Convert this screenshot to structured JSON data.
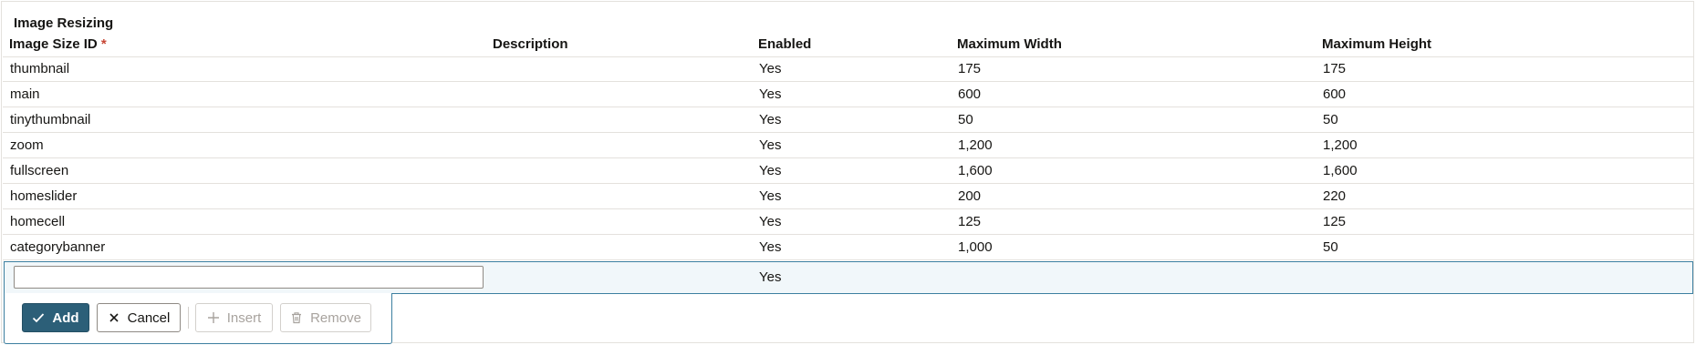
{
  "section": {
    "title": "Image Resizing"
  },
  "columns": {
    "id": "Image Size ID",
    "id_required_mark": "*",
    "description": "Description",
    "enabled": "Enabled",
    "max_width": "Maximum Width",
    "max_height": "Maximum Height"
  },
  "rows": [
    {
      "id": "thumbnail",
      "description": "",
      "enabled": "Yes",
      "max_width": "175",
      "max_height": "175"
    },
    {
      "id": "main",
      "description": "",
      "enabled": "Yes",
      "max_width": "600",
      "max_height": "600"
    },
    {
      "id": "tinythumbnail",
      "description": "",
      "enabled": "Yes",
      "max_width": "50",
      "max_height": "50"
    },
    {
      "id": "zoom",
      "description": "",
      "enabled": "Yes",
      "max_width": "1,200",
      "max_height": "1,200"
    },
    {
      "id": "fullscreen",
      "description": "",
      "enabled": "Yes",
      "max_width": "1,600",
      "max_height": "1,600"
    },
    {
      "id": "homeslider",
      "description": "",
      "enabled": "Yes",
      "max_width": "200",
      "max_height": "220"
    },
    {
      "id": "homecell",
      "description": "",
      "enabled": "Yes",
      "max_width": "125",
      "max_height": "125"
    },
    {
      "id": "categorybanner",
      "description": "",
      "enabled": "Yes",
      "max_width": "1,000",
      "max_height": "50"
    }
  ],
  "edit_row": {
    "id_value": "",
    "enabled": "Yes"
  },
  "toolbar": {
    "add_label": "Add",
    "cancel_label": "Cancel",
    "insert_label": "Insert",
    "remove_label": "Remove"
  },
  "icons": {
    "add": "check-icon",
    "cancel": "close-icon",
    "insert": "plus-icon",
    "remove": "trash-icon"
  },
  "colors": {
    "primary": "#2c5f78",
    "required": "#c74634",
    "edit_row_bg": "#f1f7fa",
    "edit_row_border": "#3c7fa0"
  }
}
